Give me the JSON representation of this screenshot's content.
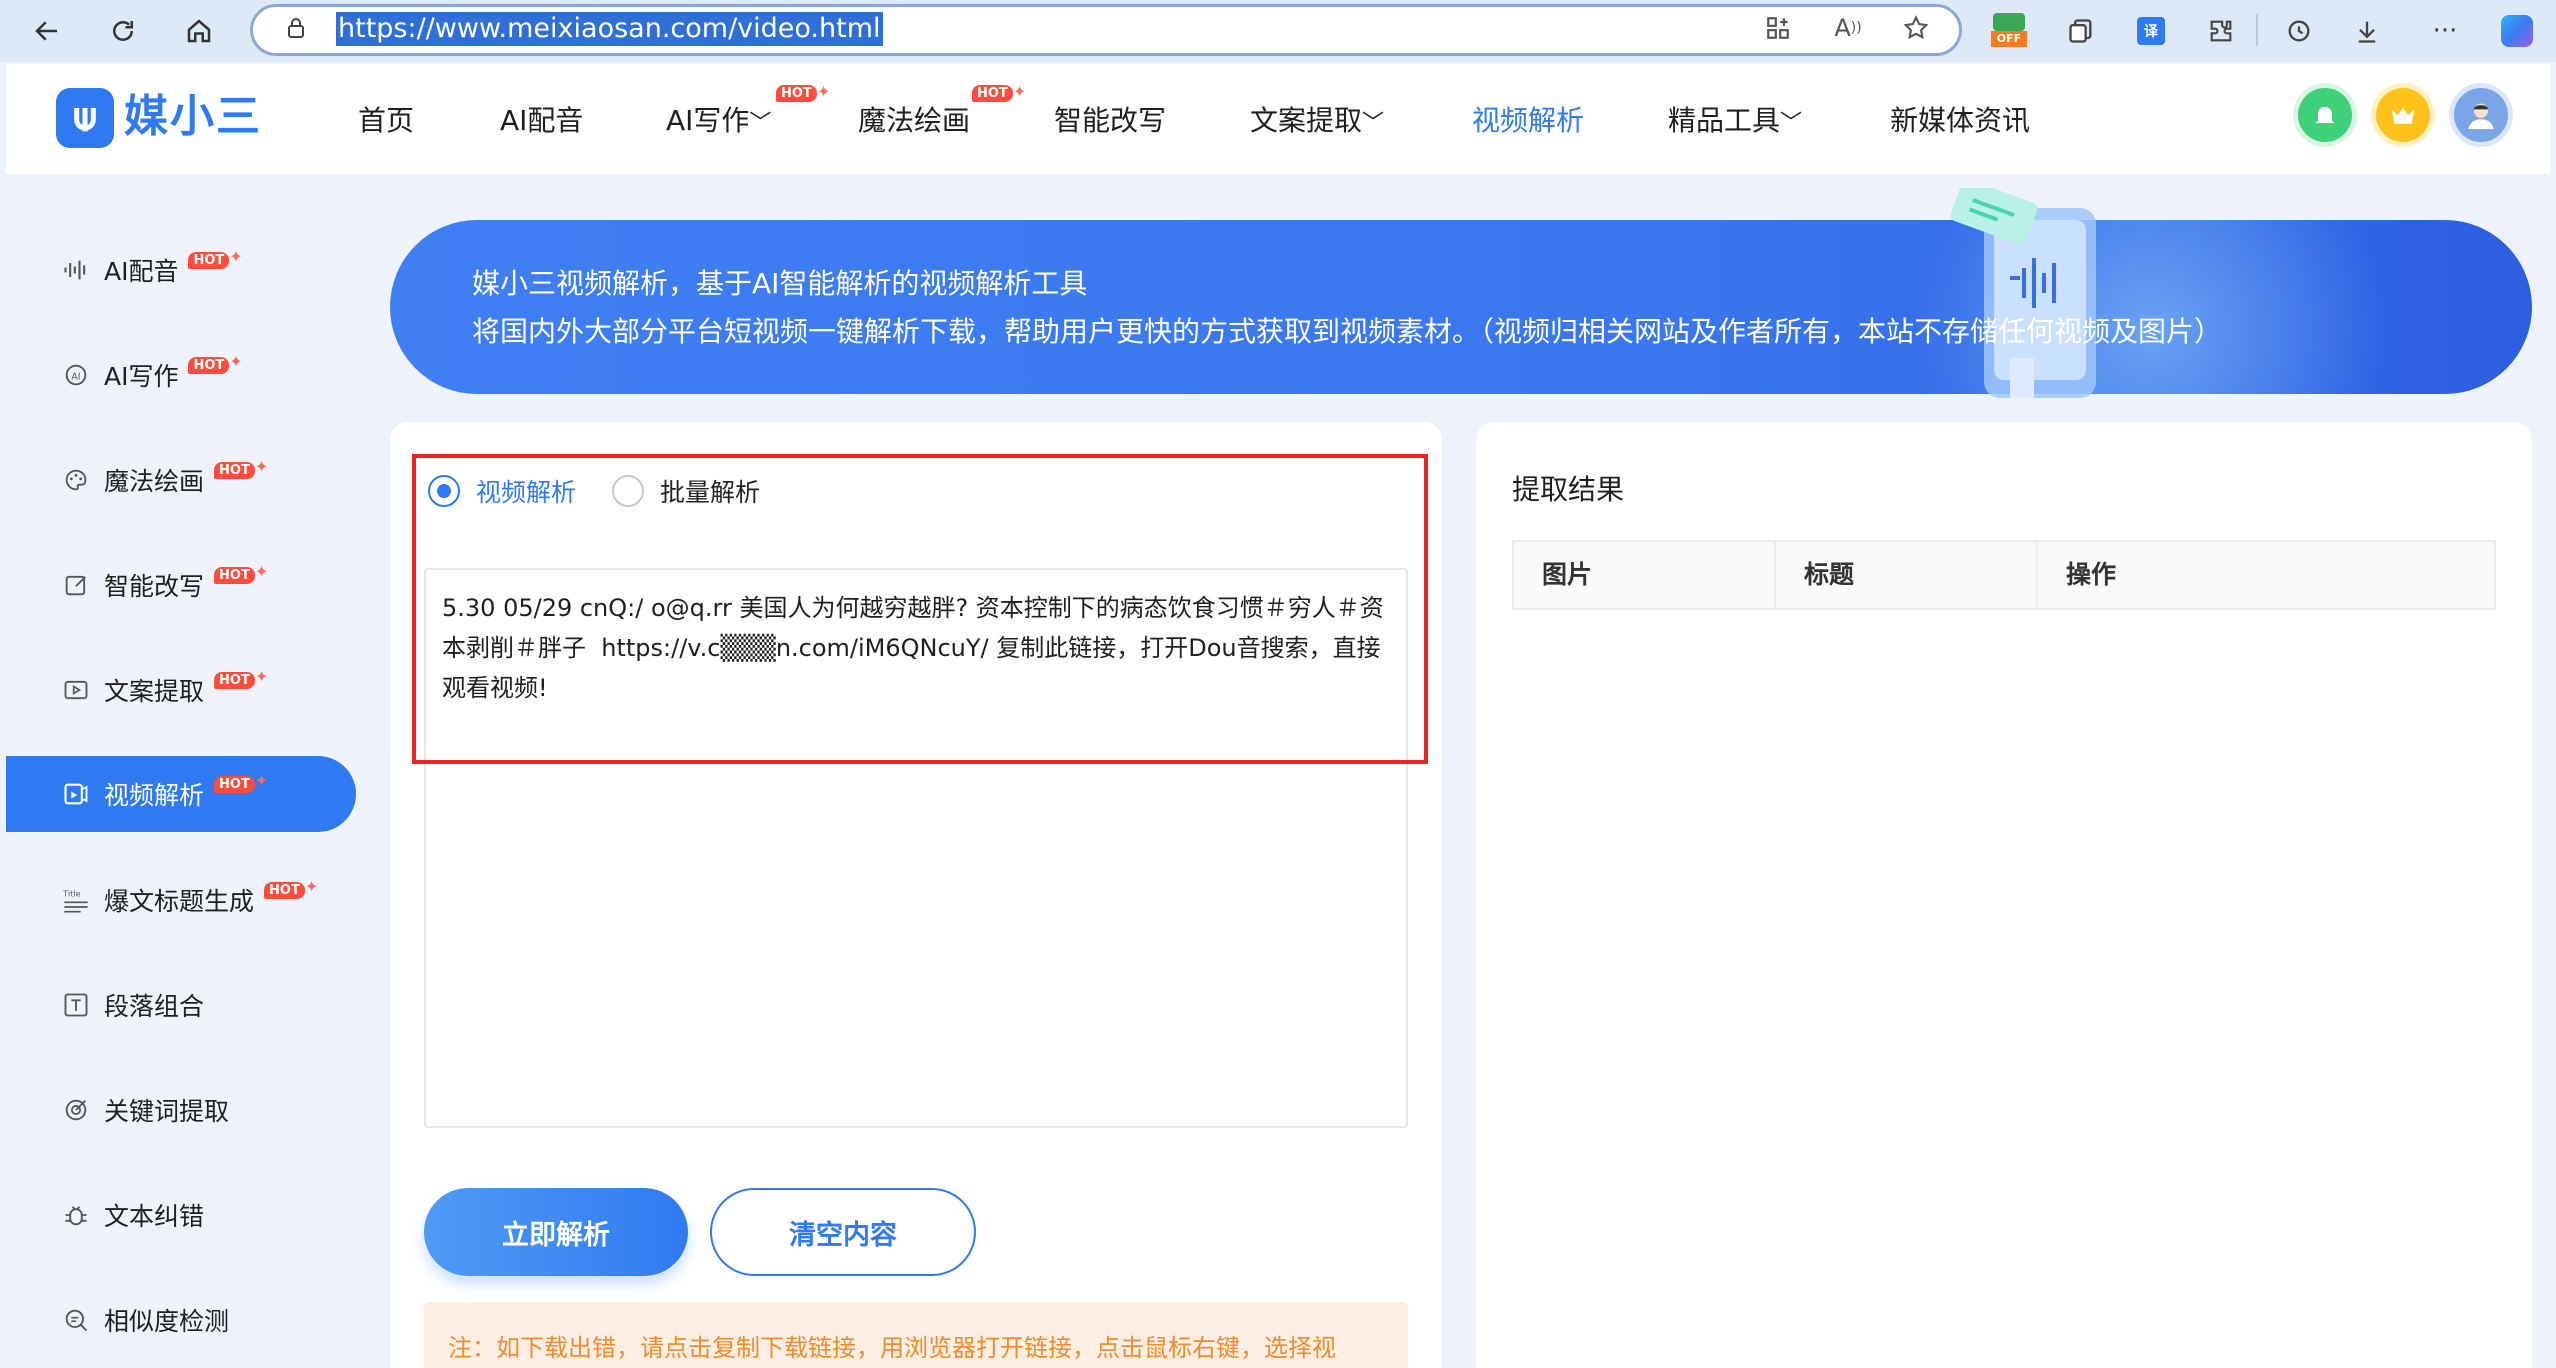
{
  "browser": {
    "url": "https://www.meixiaosan.com/video.html",
    "extension_badge": "OFF",
    "icons": [
      "back-icon",
      "refresh-icon",
      "home-icon",
      "lock-icon",
      "apps-icon",
      "read-aloud-icon",
      "favorite-star-icon",
      "collections-icon",
      "translate-icon",
      "extensions-icon",
      "history-icon",
      "download-icon",
      "more-icon",
      "copilot-icon"
    ]
  },
  "header": {
    "logo_text": "媒小三",
    "nav": [
      {
        "label": "首页"
      },
      {
        "label": "AI配音"
      },
      {
        "label": "AI写作",
        "badge": "HOT",
        "dropdown": true
      },
      {
        "label": "魔法绘画",
        "badge": "HOT"
      },
      {
        "label": "智能改写"
      },
      {
        "label": "文案提取",
        "dropdown": true
      },
      {
        "label": "视频解析",
        "active": true
      },
      {
        "label": "精品工具",
        "dropdown": true
      },
      {
        "label": "新媒体资讯"
      }
    ],
    "icons": [
      "bell-icon",
      "crown-icon",
      "avatar"
    ]
  },
  "sidebar": {
    "items": [
      {
        "label": "AI配音",
        "icon": "waveform-icon",
        "badge": "HOT"
      },
      {
        "label": "AI写作",
        "icon": "ai-write-icon",
        "badge": "HOT"
      },
      {
        "label": "魔法绘画",
        "icon": "palette-icon",
        "badge": "HOT"
      },
      {
        "label": "智能改写",
        "icon": "edit-icon",
        "badge": "HOT"
      },
      {
        "label": "文案提取",
        "icon": "video-text-icon",
        "badge": "HOT"
      },
      {
        "label": "视频解析",
        "icon": "video-parse-icon",
        "badge": "HOT",
        "active": true
      },
      {
        "label": "爆文标题生成",
        "icon": "title-icon",
        "badge": "HOT"
      },
      {
        "label": "段落组合",
        "icon": "text-block-icon"
      },
      {
        "label": "关键词提取",
        "icon": "target-icon"
      },
      {
        "label": "文本纠错",
        "icon": "bug-icon"
      },
      {
        "label": "相似度检测",
        "icon": "search-doc-icon"
      }
    ]
  },
  "banner": {
    "line1": "媒小三视频解析，基于AI智能解析的视频解析工具",
    "line2": "将国内外大部分平台短视频一键解析下载，帮助用户更快的方式获取到视频素材。（视频归相关网站及作者所有，本站不存储任何视频及图片）"
  },
  "form": {
    "mode_single": "视频解析",
    "mode_batch": "批量解析",
    "input_value": "5.30 05/29 cnQ:/ o@q.rr 美国人为何越穷越胖? 资本控制下的病态饮食习惯＃穷人＃资本剥削＃胖子  https://v.c▒▒▒n.com/iM6QNcuY/ 复制此链接，打开Dou音搜索，直接观看视频!",
    "parse_button": "立即解析",
    "clear_button": "清空内容",
    "notice": "注：如下载出错，请点击复制下载链接，用浏览器打开链接，点击鼠标右键，选择视"
  },
  "results": {
    "title": "提取结果",
    "columns": [
      "图片",
      "标题",
      "操作"
    ]
  },
  "colors": {
    "accent": "#2f7af0",
    "highlight_border": "#e82424",
    "hot_badge": "#ff4c3c",
    "notice_text": "#f28b2c"
  }
}
